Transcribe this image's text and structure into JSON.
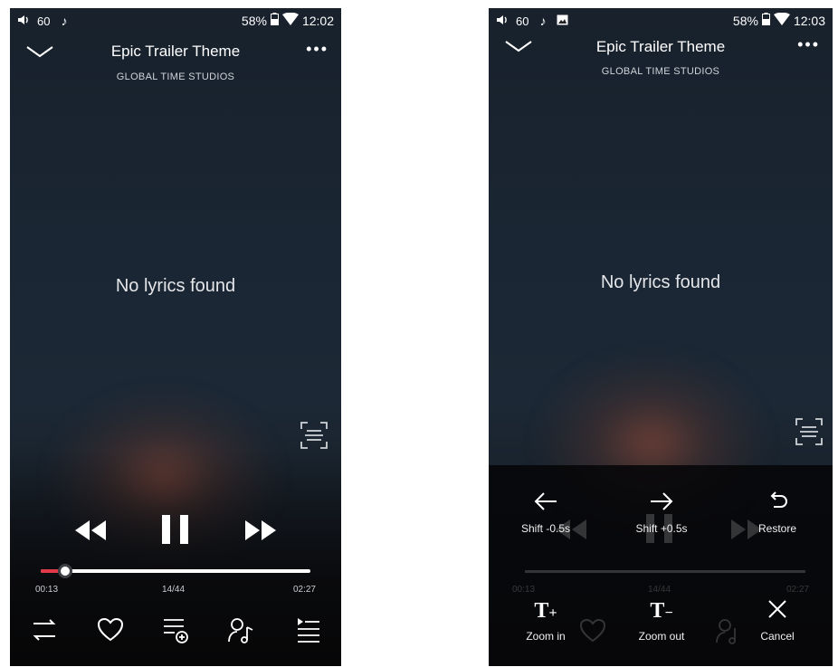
{
  "left": {
    "status": {
      "volume": "60",
      "battery": "58%",
      "time": "12:02"
    },
    "song": {
      "title": "Epic Trailer Theme",
      "artist": "GLOBAL TIME STUDIOS"
    },
    "lyrics": "No lyrics found",
    "progress": {
      "elapsed": "00:13",
      "track_index": "14/44",
      "duration": "02:27",
      "fraction": 0.09
    },
    "colors": {
      "accent": "#e23a4a"
    }
  },
  "right": {
    "status": {
      "volume": "60",
      "battery": "58%",
      "time": "12:03"
    },
    "song": {
      "title": "Epic Trailer Theme",
      "artist": "GLOBAL TIME STUDIOS"
    },
    "lyrics": "No lyrics found",
    "menu": {
      "shift_back": "Shift -0.5s",
      "shift_forward": "Shift +0.5s",
      "restore": "Restore",
      "zoom_in": "Zoom in",
      "zoom_out": "Zoom out",
      "cancel": "Cancel"
    },
    "ghost": {
      "elapsed": "00:13",
      "track_index": "14/44",
      "duration": "02:27"
    }
  },
  "icons": [
    "volume-icon",
    "music-note-icon",
    "image-icon",
    "battery-icon",
    "wifi-icon",
    "chevron-down-icon",
    "more-icon",
    "scan-lyrics-icon",
    "rewind-icon",
    "pause-icon",
    "fast-forward-icon",
    "shuffle-icon",
    "heart-icon",
    "add-to-playlist-icon",
    "artist-icon",
    "queue-icon",
    "arrow-left-icon",
    "arrow-right-icon",
    "undo-icon",
    "text-larger-icon",
    "text-smaller-icon",
    "close-icon"
  ]
}
